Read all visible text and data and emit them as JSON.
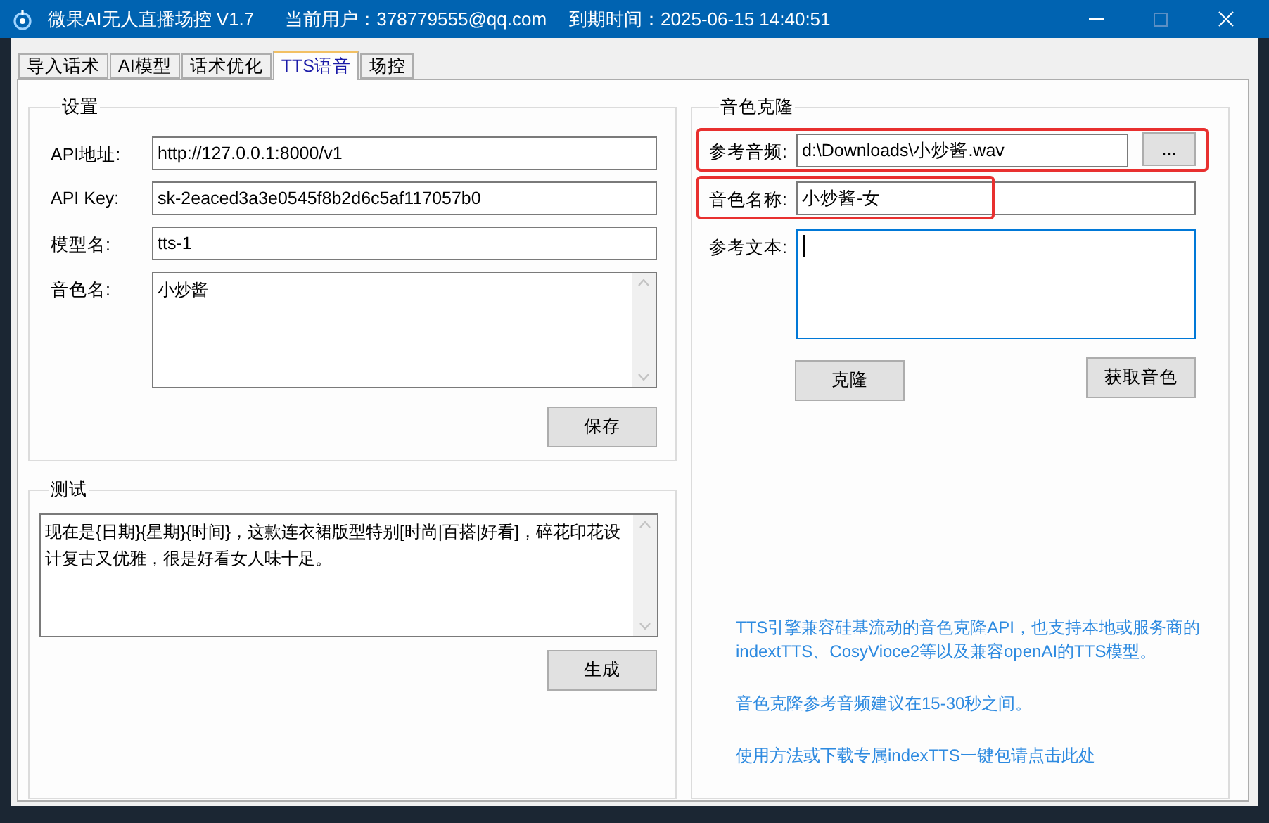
{
  "window": {
    "title": "微果AI无人直播场控 V1.7",
    "user": "当前用户：378779555@qq.com",
    "expiry": "到期时间：2025-06-15 14:40:51",
    "controls": [
      {
        "kind": "minimize",
        "disabled": false
      },
      {
        "kind": "maximize",
        "disabled": true
      },
      {
        "kind": "close",
        "disabled": false
      }
    ]
  },
  "tabs": [
    {
      "label": "导入话术",
      "selected": false
    },
    {
      "label": "AI模型",
      "selected": false
    },
    {
      "label": "话术优化",
      "selected": false
    },
    {
      "label": "TTS语音",
      "selected": true
    },
    {
      "label": "场控",
      "selected": false
    }
  ],
  "settings": {
    "title": "设置",
    "fields": [
      {
        "label": "API地址:",
        "value": "http://127.0.0.1:8000/v1",
        "kind": "input"
      },
      {
        "label": "API Key:",
        "value": "sk-2eaced3a3e0545f8b2d6c5af117057b0",
        "kind": "input"
      },
      {
        "label": "模型名:",
        "value": "tts-1",
        "kind": "input"
      },
      {
        "label": "音色名:",
        "value": "小炒酱",
        "kind": "textarea"
      }
    ],
    "button": "保存"
  },
  "test": {
    "title": "测试",
    "text": "现在是{日期}{星期}{时间}，这款连衣裙版型特别[时尚|百搭|好看]，碎花印花设计复古又优雅，很是好看女人味十足。",
    "button": "生成"
  },
  "clone": {
    "title": "音色克隆",
    "fields": [
      {
        "label": "参考音频:",
        "value": "d:\\Downloads\\小炒酱.wav",
        "kind": "file",
        "browse": "...",
        "highlighted": true,
        "focused": false
      },
      {
        "label": "音色名称:",
        "value": "小炒酱-女",
        "kind": "input",
        "highlighted": true,
        "focused": false
      },
      {
        "label": "参考文本:",
        "kind": "textarea",
        "highlighted": false,
        "focused": true
      }
    ],
    "buttons": [
      "克隆",
      "获取音色"
    ],
    "notes": [
      {
        "text": "TTS引擎兼容硅基流动的音色克隆API，也支持本地或服务商的indextTTS、CosyVioce2等以及兼容openAI的TTS模型。",
        "kind": "text"
      },
      {
        "text": "音色克隆参考音频建议在15-30秒之间。",
        "kind": "text"
      },
      {
        "text": "使用方法或下载专属indexTTS一键包请点击此处",
        "kind": "link"
      }
    ]
  }
}
